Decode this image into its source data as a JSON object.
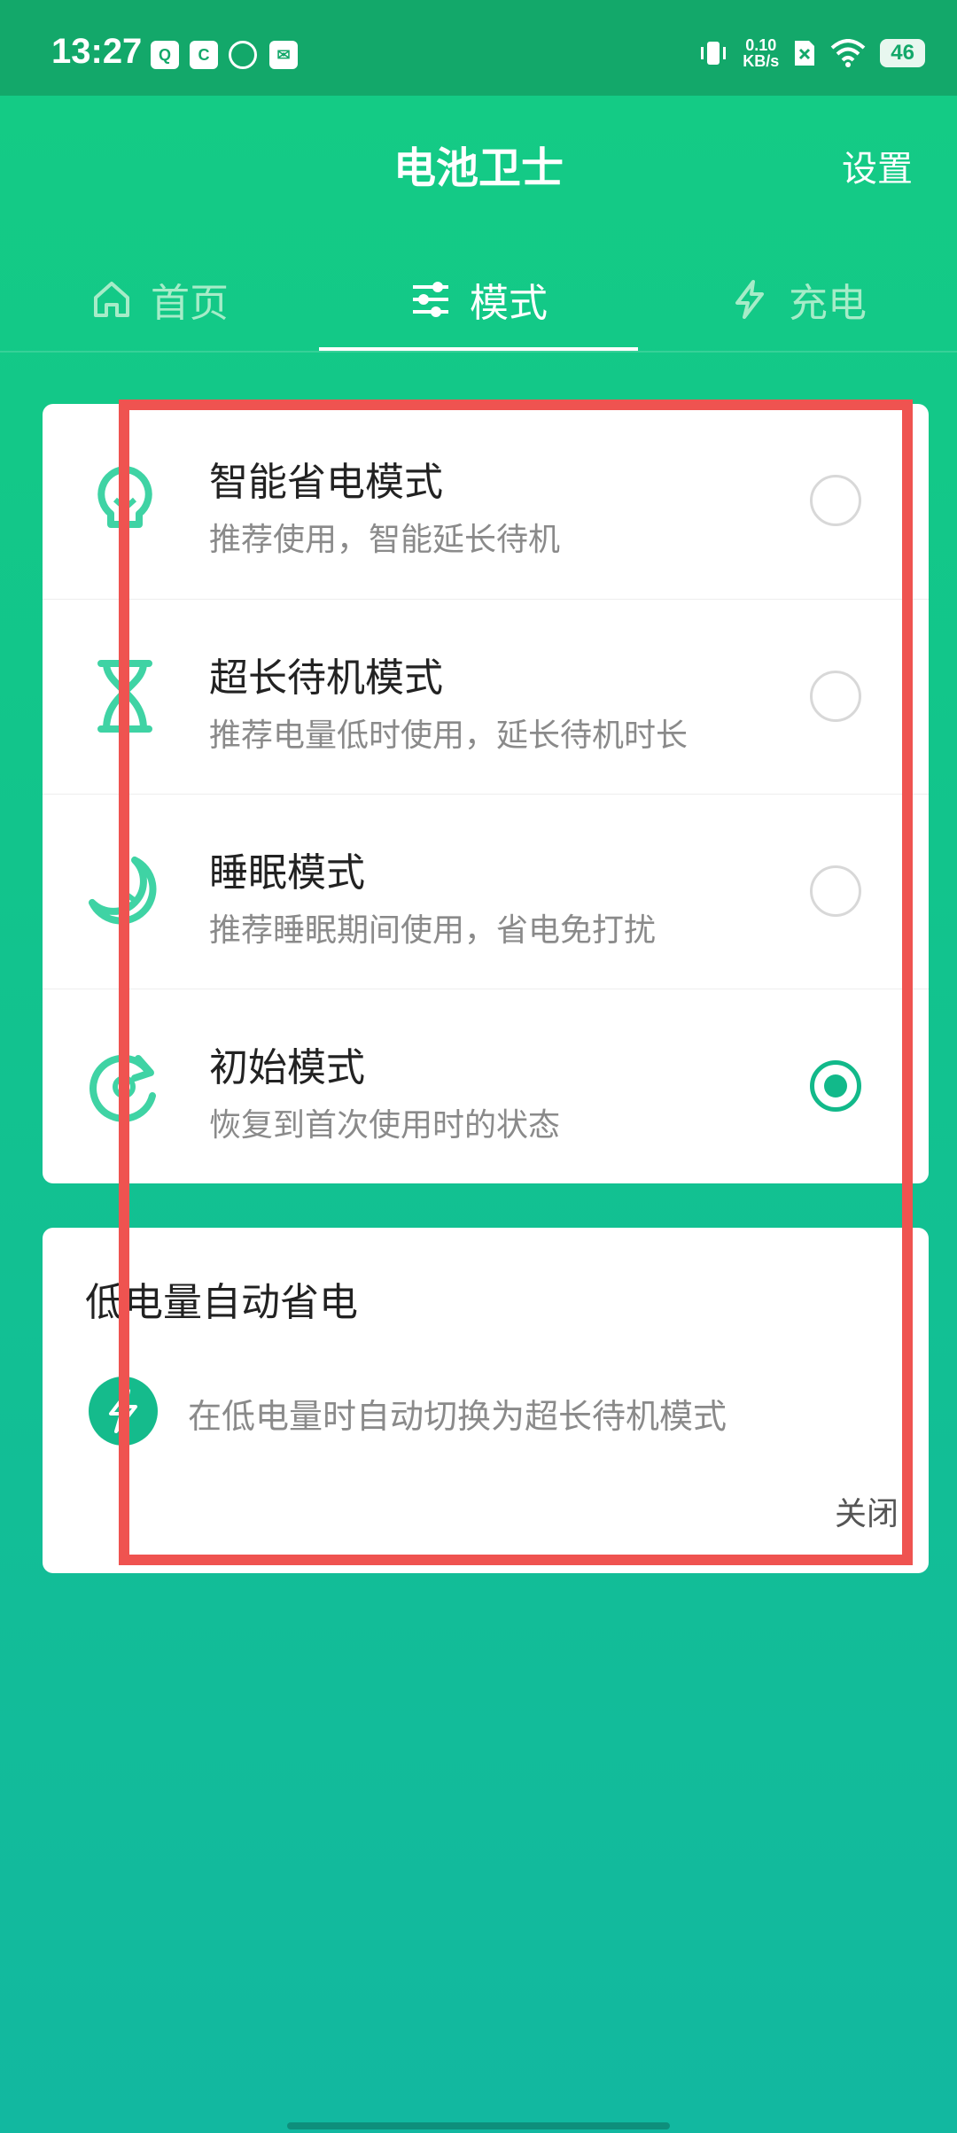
{
  "status_bar": {
    "time": "13:27",
    "app_icons": [
      "qq-icon",
      "cc-icon",
      "leaf-icon",
      "bag-icon"
    ],
    "net_speed_value": "0.10",
    "net_speed_unit": "KB/s",
    "battery": "46"
  },
  "header": {
    "title": "电池卫士",
    "settings_label": "设置"
  },
  "tabs": [
    {
      "label": "首页",
      "icon": "home-icon",
      "active": false
    },
    {
      "label": "模式",
      "icon": "sliders-icon",
      "active": true
    },
    {
      "label": "充电",
      "icon": "lightning-icon",
      "active": false
    }
  ],
  "modes": [
    {
      "title": "智能省电模式",
      "subtitle": "推荐使用，智能延长待机",
      "icon": "lightbulb-icon",
      "selected": false
    },
    {
      "title": "超长待机模式",
      "subtitle": "推荐电量低时使用，延长待机时长",
      "icon": "hourglass-icon",
      "selected": false
    },
    {
      "title": "睡眠模式",
      "subtitle": "推荐睡眠期间使用，省电免打扰",
      "icon": "moon-icon",
      "selected": false
    },
    {
      "title": "初始模式",
      "subtitle": "恢复到首次使用时的状态",
      "icon": "reset-icon",
      "selected": true
    }
  ],
  "low_battery": {
    "title": "低电量自动省电",
    "description": "在低电量时自动切换为超长待机模式",
    "status": "关闭",
    "icon": "lightning-icon"
  },
  "colors": {
    "accent": "#12b98a",
    "header_bg": "#14cc84",
    "highlight": "#ef5350"
  }
}
